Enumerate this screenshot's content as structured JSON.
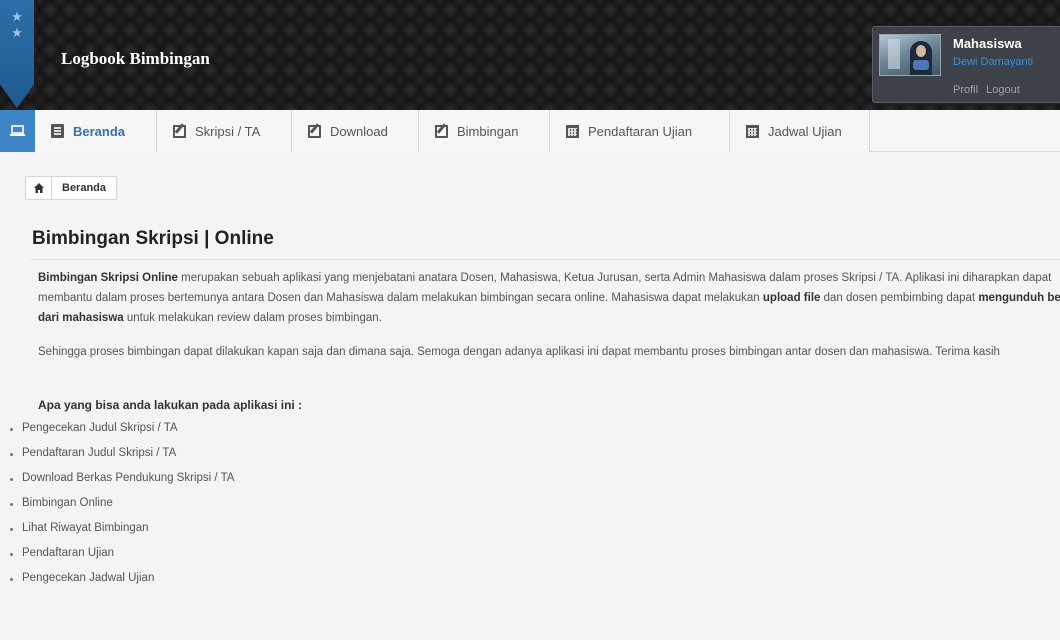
{
  "header": {
    "app_title": "Logbook Bimbingan",
    "user_role": "Mahasiswa",
    "user_name": "Dewi Damayanti",
    "profile_link": "Profil",
    "logout_link": "Logout"
  },
  "nav": {
    "home_icon": "laptop-icon",
    "tabs": [
      {
        "label": "Beranda",
        "icon": "document-icon",
        "active": true
      },
      {
        "label": "Skripsi / TA",
        "icon": "edit-icon"
      },
      {
        "label": "Download",
        "icon": "edit-icon"
      },
      {
        "label": "Bimbingan",
        "icon": "edit-icon"
      },
      {
        "label": "Pendaftaran Ujian",
        "icon": "calendar-icon"
      },
      {
        "label": "Jadwal Ujian",
        "icon": "calendar-icon"
      }
    ]
  },
  "breadcrumb": {
    "icon": "home-icon",
    "label": "Beranda"
  },
  "main": {
    "title": "Bimbingan Skripsi | Online",
    "para1": {
      "b1": "Bimbingan Skripsi Online",
      "t1": " merupakan sebuah aplikasi yang menjebatani anatara Dosen, Mahasiswa, Ketua Jurusan, serta Admin Mahasiswa dalam proses Skripsi / TA. Aplikasi ini diharapkan dapat membantu dalam proses bertemunya antara Dosen dan Mahasiswa dalam melakukan bimbingan secara online. Mahasiswa dapat melakukan ",
      "b2": "upload file",
      "t2": " dan dosen pembimbing dapat ",
      "b3": "mengunduh berkas dari mahasiswa",
      "t3": " untuk melakukan review dalam proses bimbingan."
    },
    "para2": "Sehingga proses bimbingan dapat dilakukan kapan saja dan dimana saja. Semoga dengan adanya aplikasi ini dapat membantu proses bimbingan antar dosen dan mahasiswa. Terima kasih",
    "features_heading": "Apa yang bisa anda lakukan pada aplikasi ini :",
    "features": [
      "Pengecekan Judul Skripsi / TA",
      "Pendaftaran Judul Skripsi / TA",
      "Download Berkas Pendukung Skripsi / TA",
      "Bimbingan Online",
      "Lihat Riwayat Bimbingan",
      "Pendaftaran Ujian",
      "Pengecekan Jadwal Ujian"
    ]
  },
  "colors": {
    "header_bg": "#161616",
    "nav_accent": "#3e85c6",
    "active_tab_text": "#3a6fa8",
    "user_name": "#3b8fe0"
  }
}
